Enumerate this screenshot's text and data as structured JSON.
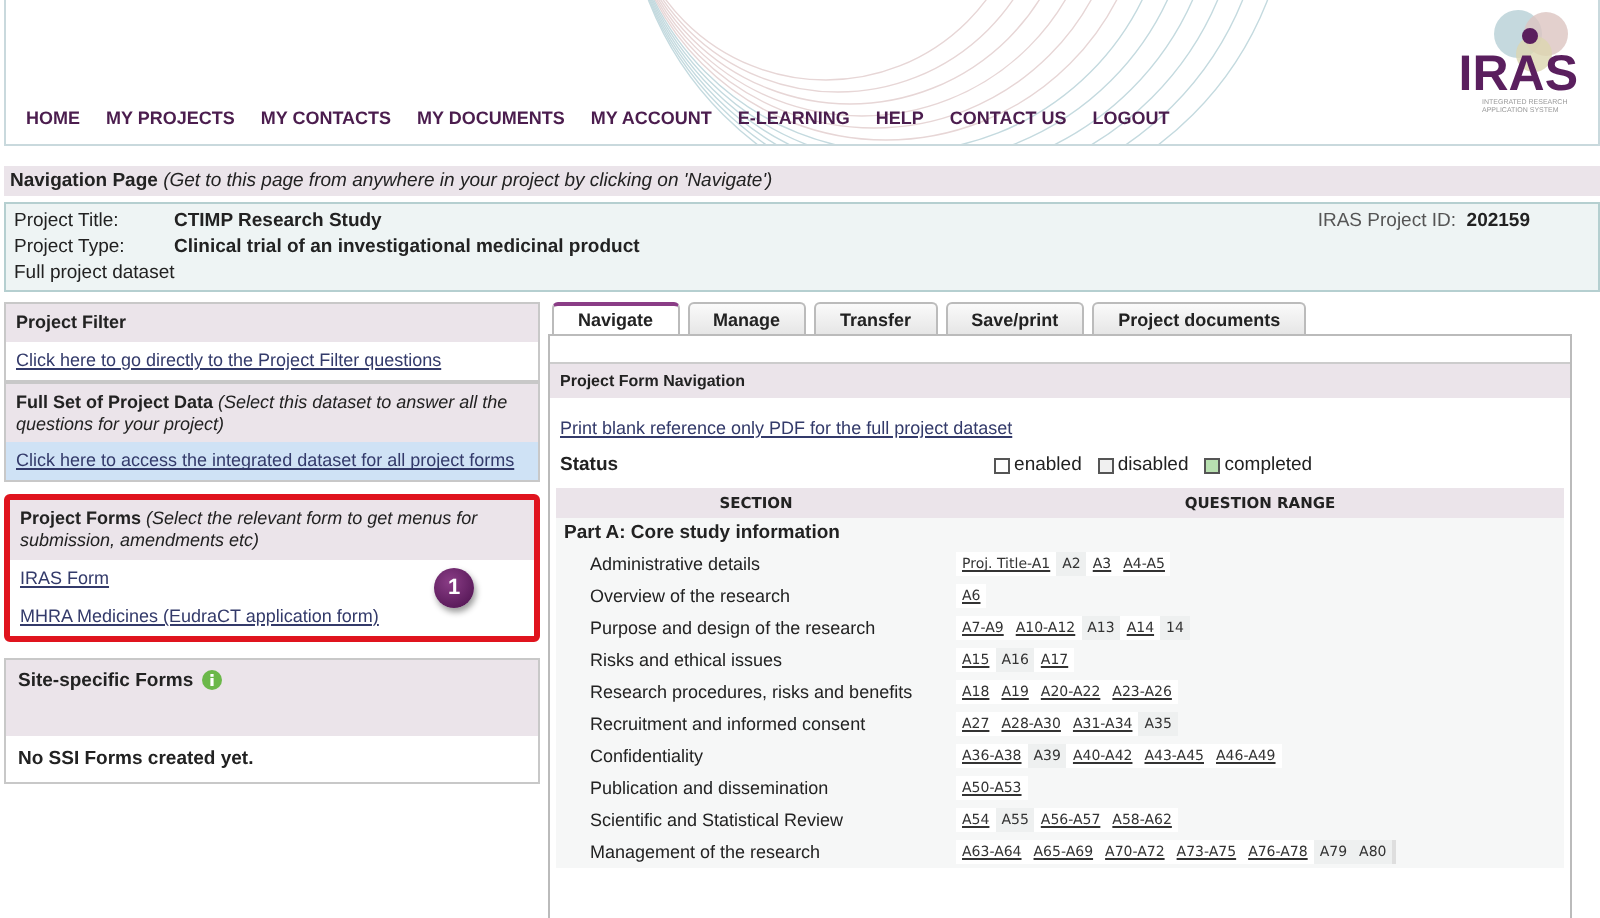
{
  "logo": {
    "name": "IRAS",
    "tagline": "INTEGRATED RESEARCH APPLICATION SYSTEM"
  },
  "menu": [
    "HOME",
    "MY PROJECTS",
    "MY CONTACTS",
    "MY DOCUMENTS",
    "MY ACCOUNT",
    "E-LEARNING",
    "HELP",
    "CONTACT US",
    "LOGOUT"
  ],
  "page_bar": {
    "title": "Navigation Page",
    "hint": "(Get to this page from anywhere in your project by clicking on 'Navigate')"
  },
  "project": {
    "title_label": "Project Title:",
    "title": "CTIMP Research Study",
    "type_label": "Project Type:",
    "type": "Clinical trial of an investigational medicinal product",
    "dataset": "Full project dataset",
    "id_label": "IRAS Project ID:",
    "id": "202159"
  },
  "left_panels": [
    {
      "heading": "Project Filter",
      "links": [
        "Click here to go directly to the Project Filter questions"
      ],
      "highlighted": false
    },
    {
      "heading": "Full Set of Project Data",
      "note": "(Select this dataset to answer all the questions for your project)",
      "links": [
        "Click here to access the integrated dataset for all project forms"
      ],
      "highlighted": false
    },
    {
      "heading": "Project Forms",
      "note": "(Select the relevant form to get menus for submission, amendments etc)",
      "links": [
        "IRAS Form",
        "MHRA Medicines (EudraCT application form)"
      ],
      "highlighted": true,
      "callout": "1"
    }
  ],
  "site_forms": {
    "heading": "Site-specific Forms",
    "message": "No SSI Forms created yet."
  },
  "tabs": [
    {
      "label": "Navigate",
      "selected": true
    },
    {
      "label": "Manage",
      "selected": false
    },
    {
      "label": "Transfer",
      "selected": false
    },
    {
      "label": "Save/print",
      "selected": false
    },
    {
      "label": "Project documents",
      "selected": false
    }
  ],
  "navigation": {
    "heading": "Project Form Navigation",
    "print_link": "Print blank reference only PDF for the full project dataset",
    "status_label": "Status",
    "legend": [
      {
        "label": "enabled",
        "color": "#ffffff"
      },
      {
        "label": "disabled",
        "color": "#f0f0f0"
      },
      {
        "label": "completed",
        "color": "#b8e0b0"
      }
    ],
    "columns": [
      "SECTION",
      "QUESTION RANGE"
    ],
    "part": "Part A: Core study information",
    "rows": [
      {
        "section": "Administrative details",
        "ranges": [
          {
            "text": "Proj. Title-A1",
            "enabled": true
          },
          {
            "text": "A2",
            "enabled": false
          },
          {
            "text": "A3",
            "enabled": true
          },
          {
            "text": "A4-A5",
            "enabled": true
          }
        ]
      },
      {
        "section": "Overview of the research",
        "ranges": [
          {
            "text": "A6",
            "enabled": true
          }
        ]
      },
      {
        "section": "Purpose and design of the research",
        "ranges": [
          {
            "text": "A7-A9",
            "enabled": true
          },
          {
            "text": "A10-A12",
            "enabled": true
          },
          {
            "text": "A13",
            "enabled": false
          },
          {
            "text": "A14",
            "enabled": true
          },
          {
            "text": "14",
            "enabled": false
          }
        ]
      },
      {
        "section": "Risks and ethical issues",
        "ranges": [
          {
            "text": "A15",
            "enabled": true
          },
          {
            "text": "A16",
            "enabled": false
          },
          {
            "text": "A17",
            "enabled": true
          }
        ]
      },
      {
        "section": "Research procedures, risks and benefits",
        "ranges": [
          {
            "text": "A18",
            "enabled": true
          },
          {
            "text": "A19",
            "enabled": true
          },
          {
            "text": "A20-A22",
            "enabled": true
          },
          {
            "text": "A23-A26",
            "enabled": true
          }
        ]
      },
      {
        "section": "Recruitment and informed consent",
        "ranges": [
          {
            "text": "A27",
            "enabled": true
          },
          {
            "text": "A28-A30",
            "enabled": true
          },
          {
            "text": "A31-A34",
            "enabled": true
          },
          {
            "text": "A35",
            "enabled": false
          }
        ]
      },
      {
        "section": "Confidentiality",
        "ranges": [
          {
            "text": "A36-A38",
            "enabled": true
          },
          {
            "text": "A39",
            "enabled": false
          },
          {
            "text": "A40-A42",
            "enabled": true
          },
          {
            "text": "A43-A45",
            "enabled": true
          },
          {
            "text": "A46-A49",
            "enabled": true
          }
        ]
      },
      {
        "section": "Publication and dissemination",
        "ranges": [
          {
            "text": "A50-A53",
            "enabled": true
          }
        ]
      },
      {
        "section": "Scientific and Statistical Review",
        "ranges": [
          {
            "text": "A54",
            "enabled": true
          },
          {
            "text": "A55",
            "enabled": false
          },
          {
            "text": "A56-A57",
            "enabled": true
          },
          {
            "text": "A58-A62",
            "enabled": true
          }
        ]
      },
      {
        "section": "Management of the research",
        "ranges": [
          {
            "text": "A63-A64",
            "enabled": true
          },
          {
            "text": "A65-A69",
            "enabled": true
          },
          {
            "text": "A70-A72",
            "enabled": true
          },
          {
            "text": "A73-A75",
            "enabled": true
          },
          {
            "text": "A76-A78",
            "enabled": true
          },
          {
            "text": "A79",
            "enabled": false
          },
          {
            "text": "A80",
            "enabled": false
          }
        ]
      }
    ]
  }
}
